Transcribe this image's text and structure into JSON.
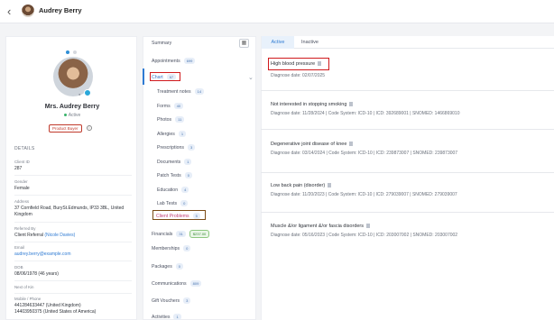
{
  "header": {
    "back_icon": "chevron-left-icon",
    "name": "Audrey Berry"
  },
  "profile": {
    "name": "Mrs. Audrey Berry",
    "status": "Active",
    "tag": "Product Buyer",
    "details_heading": "DETAILS",
    "fields": [
      {
        "label": "Client ID",
        "value": "287"
      },
      {
        "label": "Gender",
        "value": "Female"
      },
      {
        "label": "Address",
        "value": "37 Cornfield Road, BurySt.Edmunds, IP33 3BL, United Kingdom"
      },
      {
        "label": "Referred By",
        "value": "Client Referral",
        "link": "(Nicole Davies)"
      },
      {
        "label": "Email",
        "value": "audrey.berry@example.com"
      },
      {
        "label": "DOB",
        "value": "08/06/1978 (46 years)"
      },
      {
        "label": "Next of Kin",
        "value": ""
      },
      {
        "label": "Mobile / Phone",
        "value": "441284633447 (United Kingdom)"
      },
      {
        "label": "",
        "value": "14403950375 (United States of America)"
      }
    ]
  },
  "menu": {
    "items": [
      {
        "label": "Summary",
        "badge": ""
      },
      {
        "label": "Appointments",
        "badge": "699"
      },
      {
        "label": "Chart",
        "badge": "67"
      },
      {
        "label": "Treatment notes",
        "badge": "14"
      },
      {
        "label": "Forms",
        "badge": "40"
      },
      {
        "label": "Photos",
        "badge": "11"
      },
      {
        "label": "Allergies",
        "badge": "1"
      },
      {
        "label": "Prescriptions",
        "badge": "3"
      },
      {
        "label": "Documents",
        "badge": "1"
      },
      {
        "label": "Patch Tests",
        "badge": "0"
      },
      {
        "label": "Education",
        "badge": "4"
      },
      {
        "label": "Lab Tests",
        "badge": "0"
      },
      {
        "label": "Client Problems",
        "badge": "5"
      },
      {
        "label": "Financials",
        "badge": "31",
        "badge2": "$237.00"
      },
      {
        "label": "Memberships",
        "badge": "0"
      },
      {
        "label": "Packages",
        "badge": "0"
      },
      {
        "label": "Communications",
        "badge": "809"
      },
      {
        "label": "Gift Vouchers",
        "badge": "3"
      },
      {
        "label": "Activities",
        "badge": "1"
      }
    ]
  },
  "tabs": {
    "active": "Active",
    "inactive": "Inactive"
  },
  "conditions": [
    {
      "title": "High blood pressure",
      "sub": "Diagnose date: 02/07/2025"
    },
    {
      "title": "Not interested in stopping smoking",
      "sub": "Diagnose date: 11/28/2024 | Code System: ICD-10 | ICD: 392689001 | SNOMED: 1466869010"
    },
    {
      "title": "Degenerative joint disease of knee",
      "sub": "Diagnose date: 03/14/2024 | Code System: ICD-10 | ICD: 239873007 | SNOMED: 239873007"
    },
    {
      "title": "Low back pain (disorder)",
      "sub": "Diagnose date: 11/20/2023 | Code System: ICD-10 | ICD: 279039007 | SNOMED: 279039007"
    },
    {
      "title": "Muscle &/or ligament &/or fascia disorders",
      "sub": "Diagnose date: 05/16/2023 | Code System: ICD-10 | ICD: 203007002 | SNOMED: 203007002"
    }
  ]
}
